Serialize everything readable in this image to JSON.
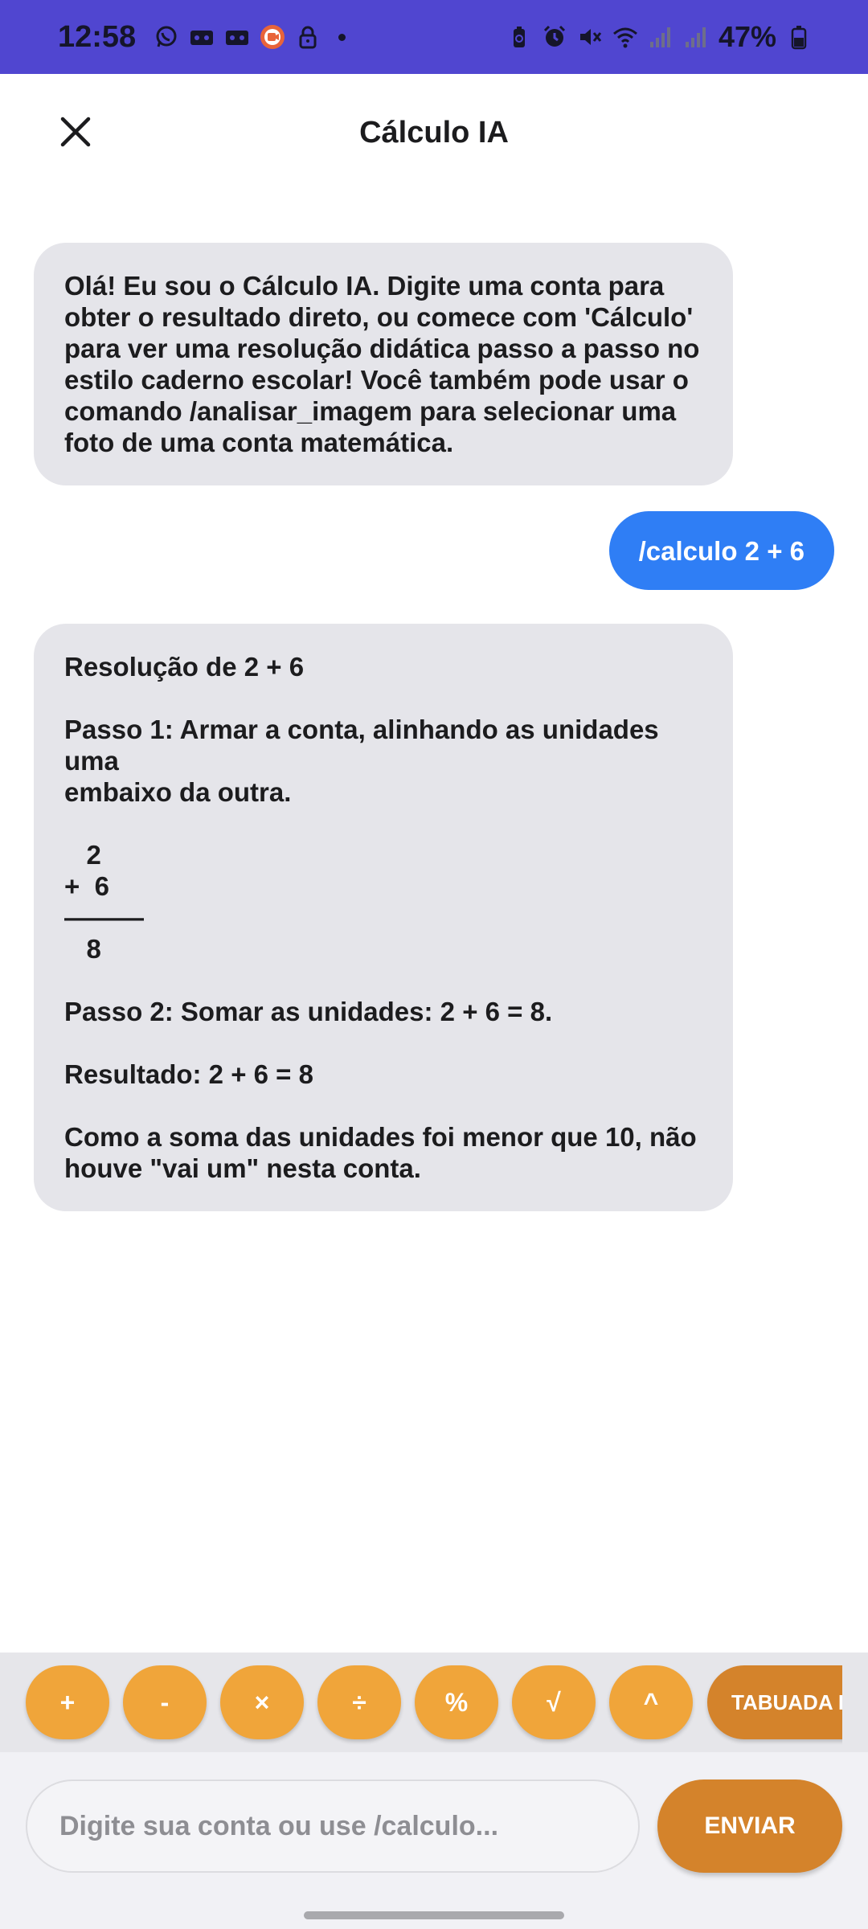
{
  "status_bar": {
    "time": "12:58",
    "battery_percent": "47%",
    "left_icons": [
      "whatsapp-icon",
      "voicemail-icon",
      "voicemail-icon",
      "screen-recorder-icon",
      "lock-icon"
    ],
    "right_icons": [
      "battery-saver-icon",
      "alarm-icon",
      "mute-icon",
      "wifi-icon",
      "signal-icon",
      "signal-icon",
      "battery-icon"
    ]
  },
  "header": {
    "title": "Cálculo IA"
  },
  "messages": [
    {
      "sender": "bot",
      "text": "Olá! Eu sou o Cálculo IA. Digite uma conta para\nobter o resultado direto, ou comece com 'Cálculo'\npara ver uma resolução didática passo a passo no\nestilo caderno escolar! Você também pode usar o\ncomando /analisar_imagem para selecionar uma\nfoto de uma conta matemática."
    },
    {
      "sender": "user",
      "text": "/calculo 2 + 6"
    },
    {
      "sender": "bot",
      "text": "Resolução de 2 + 6\n\nPasso 1: Armar a conta, alinhando as unidades uma\nembaixo da outra.\n\n   2\n+  6\n———\n   8\n\nPasso 2: Somar as unidades: 2 + 6 = 8.\n\nResultado: 2 + 6 = 8\n\nComo a soma das unidades foi menor que 10, não\nhouve \"vai um\" nesta conta."
    }
  ],
  "quick_ops": [
    "+",
    "-",
    "×",
    "÷",
    "%",
    "√",
    "^"
  ],
  "tabuada_label": "TABUADA DE",
  "input": {
    "placeholder": "Digite sua conta ou use /calculo...",
    "value": ""
  },
  "send_label": "ENVIAR",
  "colors": {
    "status_bar": "#5046d0",
    "bot_bubble": "#e5e5ea",
    "user_bubble": "#2f7ef5",
    "op_button": "#f0a53a",
    "accent_button": "#d4832b"
  }
}
